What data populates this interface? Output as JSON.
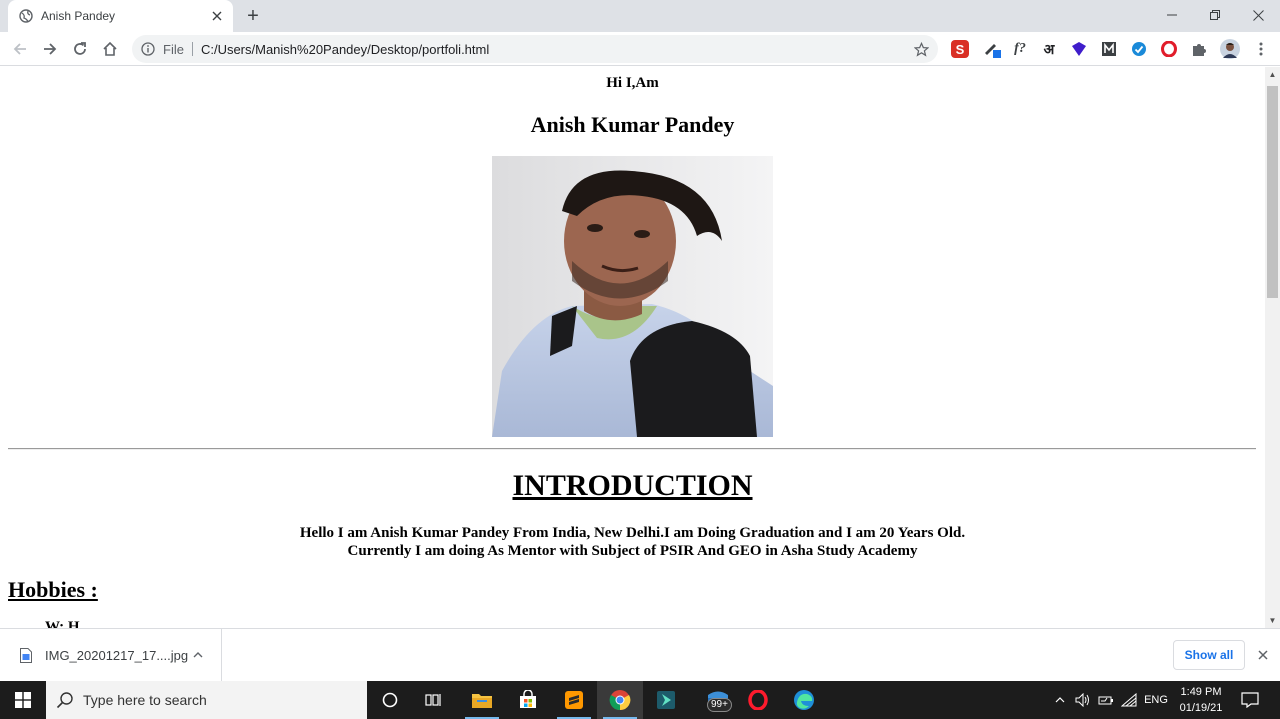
{
  "browser": {
    "tab_title": "Anish Pandey",
    "new_tab_label": "+",
    "omnibox_scheme": "File",
    "url": "C:/Users/Manish%20Pandey/Desktop/portfoli.html",
    "extensions": [
      "S",
      "f?",
      "अ"
    ]
  },
  "page": {
    "greeting": "Hi I,Am",
    "name": "Anish Kumar Pandey",
    "intro_heading": "INTRODUCTION",
    "intro_line1": "Hello I am Anish Kumar Pandey From India, New Delhi.I am Doing Graduation and I am 20 Years Old.",
    "intro_line2": "Currently I am doing As Mentor with Subject of PSIR And GEO in Asha Study Academy",
    "hobbies_heading": "Hobbies :",
    "hobby_partial": "W: H"
  },
  "downloads": {
    "file_name": "IMG_20201217_17....jpg",
    "show_all": "Show all"
  },
  "taskbar": {
    "search_placeholder": "Type here to search",
    "mail_badge": "99+",
    "language": "ENG",
    "time": "1:49 PM",
    "date": "01/19/21"
  },
  "colors": {
    "tabstrip": "#dee1e6",
    "omnibox": "#f1f3f4",
    "link_blue": "#1a73e8",
    "taskbar": "#1c1c1c"
  }
}
